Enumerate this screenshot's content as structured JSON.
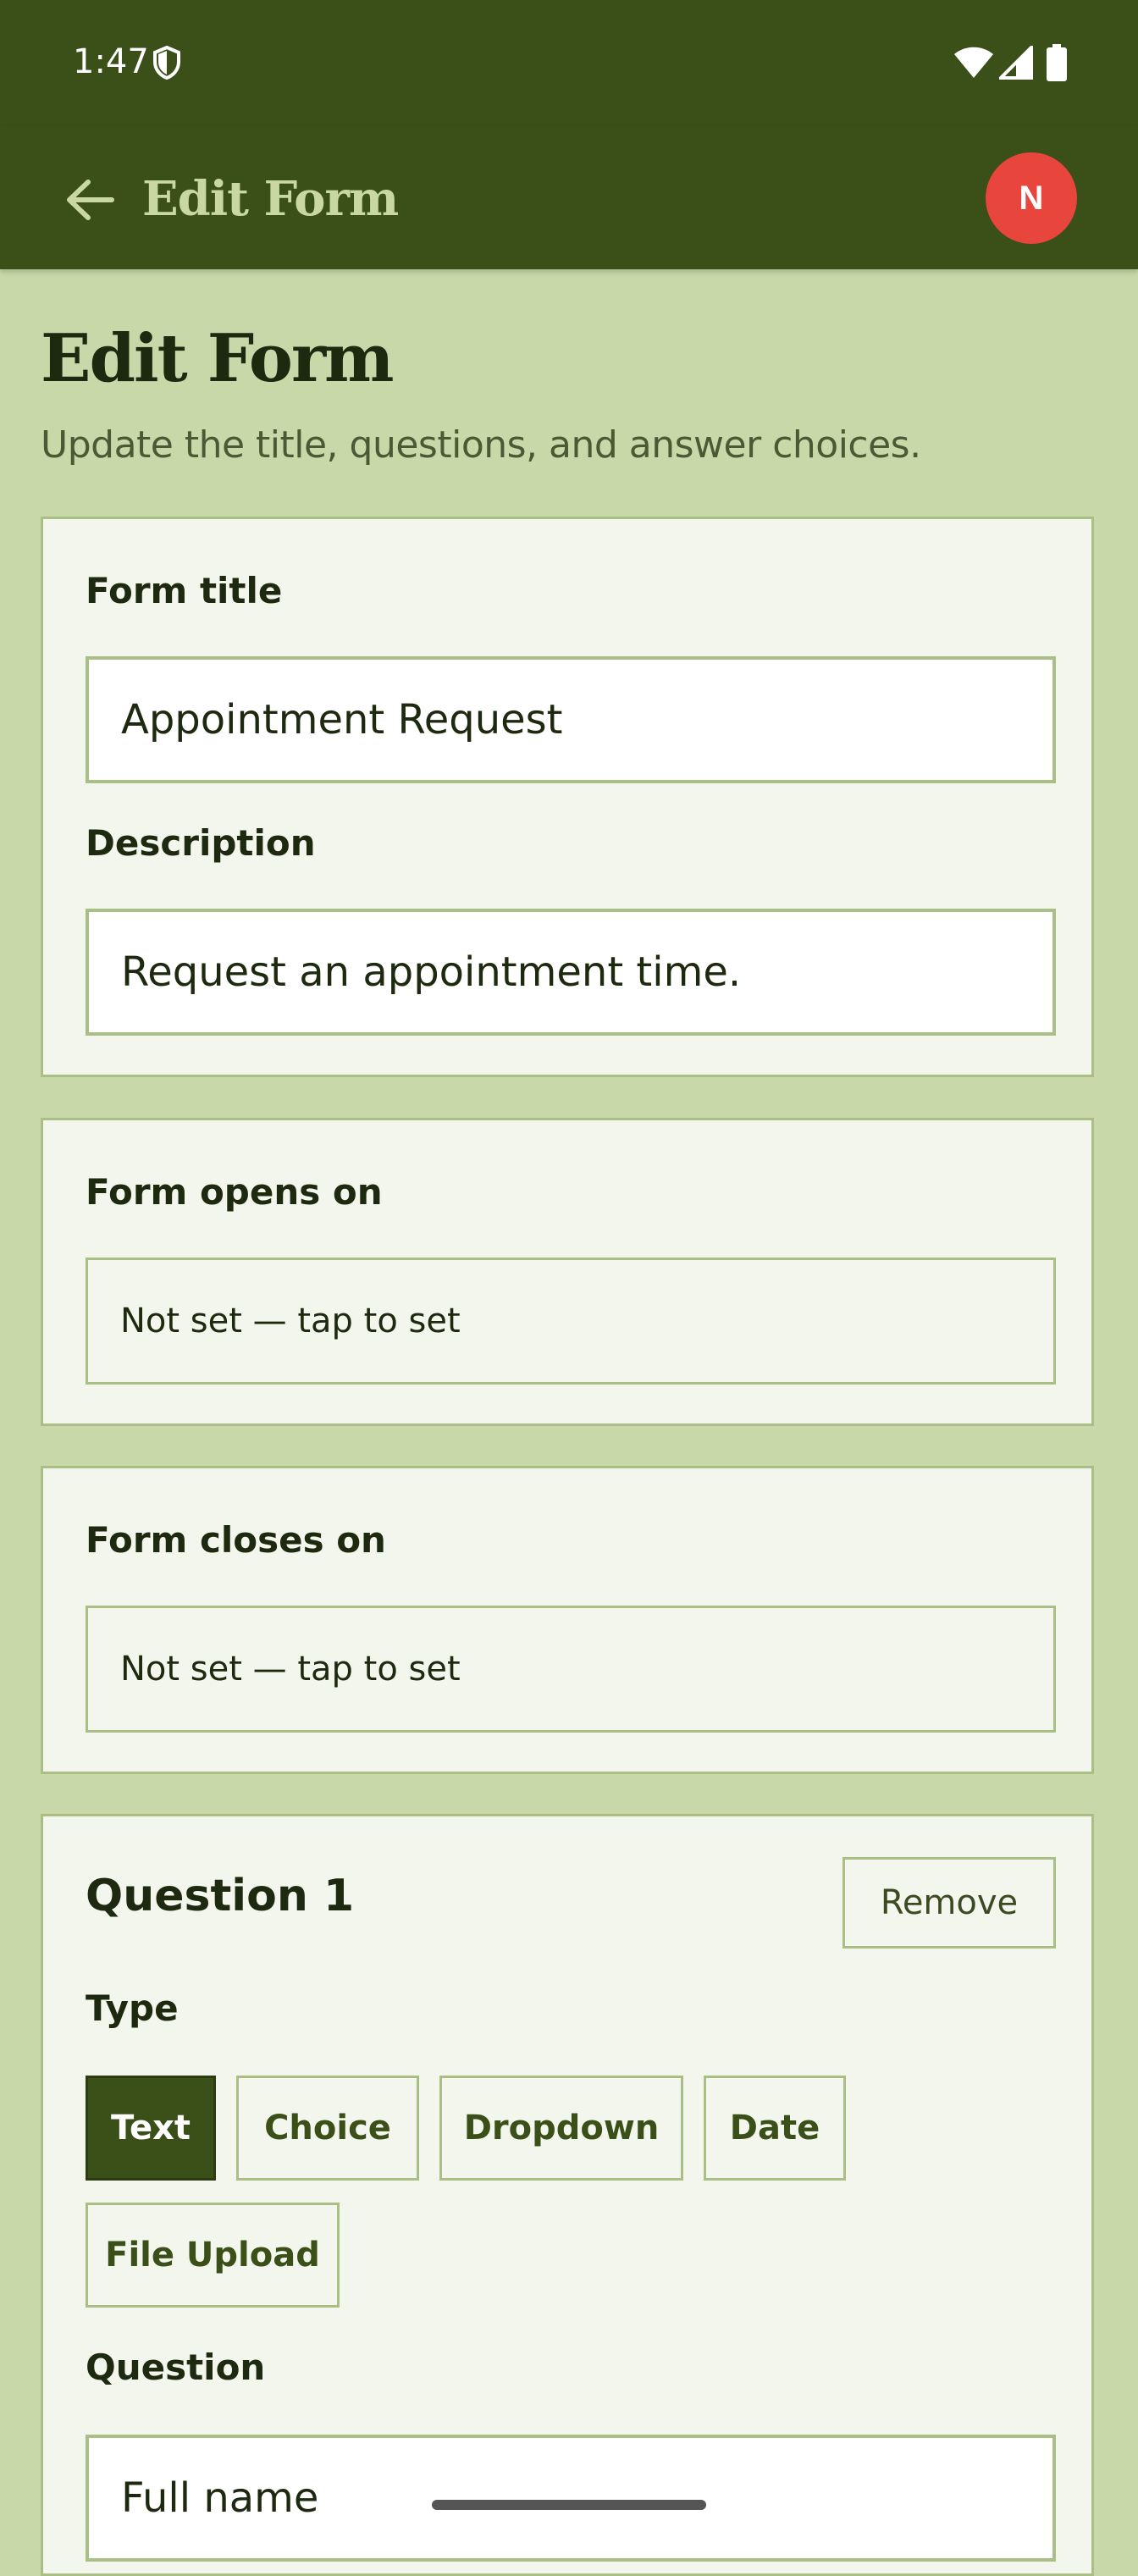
{
  "status_bar": {
    "time": "1:47"
  },
  "app_bar": {
    "title": "Edit Form",
    "avatar_initial": "N"
  },
  "header": {
    "title": "Edit Form",
    "subtitle": "Update the title, questions, and answer choices."
  },
  "details_card": {
    "title_label": "Form title",
    "title_value": "Appointment Request",
    "description_label": "Description",
    "description_value": "Request an appointment time."
  },
  "opens_card": {
    "label": "Form opens on",
    "value": "Not set — tap to set"
  },
  "closes_card": {
    "label": "Form closes on",
    "value": "Not set — tap to set"
  },
  "question_card": {
    "title": "Question 1",
    "remove_label": "Remove",
    "type_label": "Type",
    "types": [
      "Text",
      "Choice",
      "Dropdown",
      "Date",
      "File Upload"
    ],
    "selected_type": "Text",
    "question_label": "Question",
    "question_value": "Full name"
  },
  "colors": {
    "app_bar": "#3b4f18",
    "background": "#c8d8a8",
    "card": "#f3f6ec",
    "border": "#a9bf85",
    "avatar": "#e8453c"
  }
}
